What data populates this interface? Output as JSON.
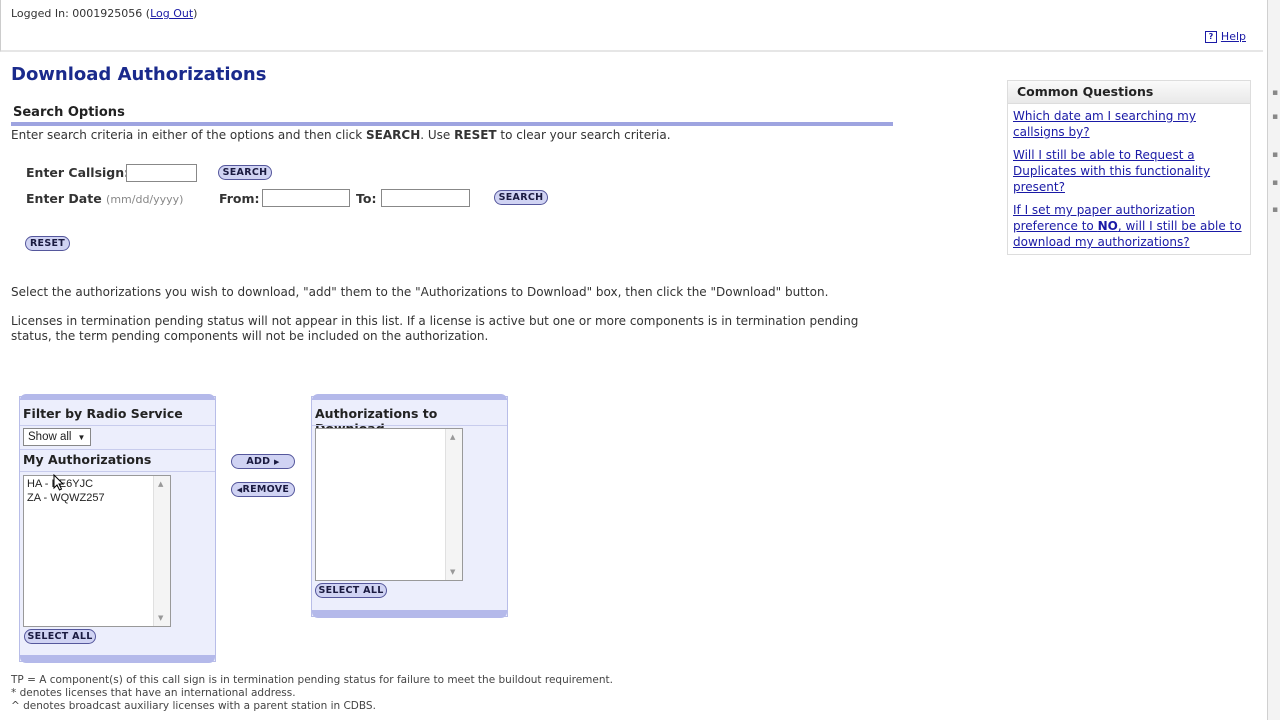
{
  "header": {
    "logged_in": "Logged In: 0001925056 (",
    "logout": "Log Out",
    "logged_close": ")",
    "help": "Help"
  },
  "page": {
    "title": "Download Authorizations",
    "search_options": "Search Options",
    "instructions_a": "Enter search criteria in either of the options and then click ",
    "instructions_search": "SEARCH",
    "instructions_b": ". Use ",
    "instructions_reset": "RESET",
    "instructions_c": " to clear your search criteria."
  },
  "search": {
    "callsign_label": "Enter Callsign:",
    "callsign_value": "",
    "search_btn": "SEARCH",
    "date_label": "Enter Date",
    "date_hint": "(mm/dd/yyyy)",
    "from_label": "From:",
    "from_value": "",
    "to_label": "To:",
    "to_value": "",
    "search_btn2": "SEARCH",
    "reset_btn": "RESET"
  },
  "body": {
    "select_text": "Select the authorizations you wish to download, \"add\" them to the \"Authorizations to Download\" box, then click the \"Download\" button.",
    "licenses_text_1": "Licenses in termination pending status will not appear in this list. If a license is active but one or more components is in termination pending",
    "licenses_text_2": "status, the term pending components will not be included on the authorization."
  },
  "filter_panel": {
    "title": "Filter by Radio Service",
    "select_value": "Show all",
    "my_auth_title": "My Authorizations",
    "items": [
      "HA - KE6YJC",
      "ZA - WQWZ257"
    ],
    "select_all": "SELECT ALL"
  },
  "actions": {
    "add": "ADD",
    "remove": "REMOVE"
  },
  "download_panel": {
    "title": "Authorizations to Download",
    "select_all": "SELECT ALL"
  },
  "common_questions": {
    "title": "Common Questions",
    "q1": "Which date am I searching my callsigns by?",
    "q2": "Will I still be able to Request a Duplicates with this functionality present?",
    "q3a": "If I set my paper authorization preference to ",
    "q3b": "NO",
    "q3c": ", will I still be able to download my authorizations?"
  },
  "footnotes": {
    "tp": "TP = A component(s) of this call sign is in termination pending status for failure to meet the buildout requirement.",
    "star": "* denotes licenses that have an international address.",
    "caret": "^ denotes broadcast auxiliary licenses with a parent station in CDBS."
  },
  "colors": {
    "title_blue": "#1a2a8c",
    "link_blue": "#1a1aa6",
    "panel_bg": "#eceefc",
    "accent": "#9ea4e0"
  }
}
